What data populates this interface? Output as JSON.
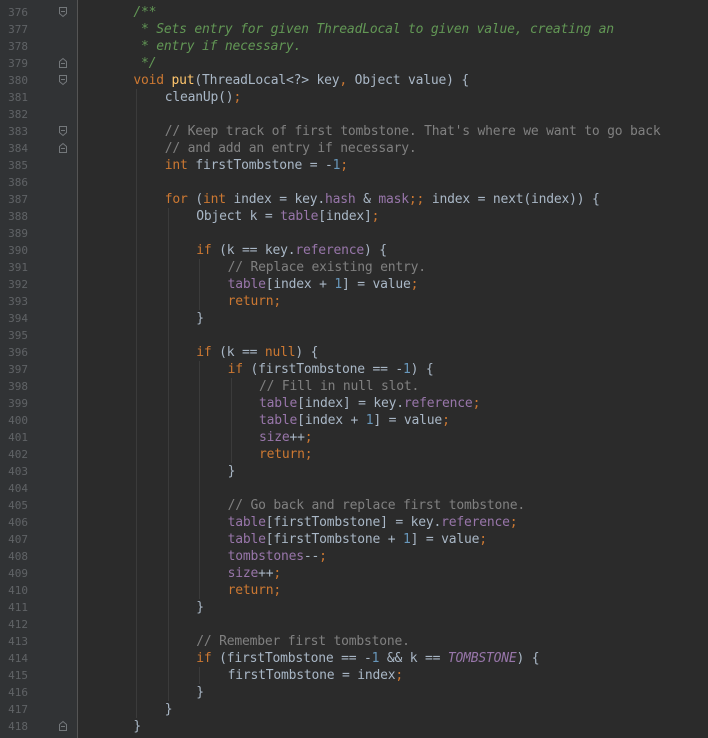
{
  "editor": {
    "colors": {
      "background": "#2b2b2b",
      "gutter": "#313335",
      "line_number": "#606366",
      "plain": "#a9b7c6",
      "keyword": "#cc7832",
      "method": "#ffc66d",
      "number": "#6897bb",
      "field": "#9876aa",
      "comment": "#808080",
      "doc_comment": "#629755"
    },
    "lines": [
      {
        "num": "376",
        "fold": "top",
        "indent": 1,
        "tokens": [
          {
            "t": "doc",
            "v": "/**"
          }
        ]
      },
      {
        "num": "377",
        "indent": 1,
        "tokens": [
          {
            "t": "doc",
            "v": " * Sets entry for given ThreadLocal to given value, creating an"
          }
        ]
      },
      {
        "num": "378",
        "indent": 1,
        "tokens": [
          {
            "t": "doc",
            "v": " * entry if necessary."
          }
        ]
      },
      {
        "num": "379",
        "fold": "bottom",
        "indent": 1,
        "tokens": [
          {
            "t": "doc",
            "v": " */"
          }
        ]
      },
      {
        "num": "380",
        "fold": "top",
        "indent": 1,
        "tokens": [
          {
            "t": "kw",
            "v": "void "
          },
          {
            "t": "fn",
            "v": "put"
          },
          {
            "t": "plain",
            "v": "(ThreadLocal<?> key"
          },
          {
            "t": "kw",
            "v": ", "
          },
          {
            "t": "plain",
            "v": "Object value) {"
          }
        ]
      },
      {
        "num": "381",
        "indent": 2,
        "tokens": [
          {
            "t": "plain",
            "v": "cleanUp()"
          },
          {
            "t": "kw",
            "v": ";"
          }
        ]
      },
      {
        "num": "382",
        "indent": 0,
        "tokens": []
      },
      {
        "num": "383",
        "fold": "top",
        "indent": 2,
        "tokens": [
          {
            "t": "com",
            "v": "// Keep track of first tombstone. That's where we want to go back"
          }
        ]
      },
      {
        "num": "384",
        "fold": "bottom",
        "indent": 2,
        "tokens": [
          {
            "t": "com",
            "v": "// and add an entry if necessary."
          }
        ]
      },
      {
        "num": "385",
        "indent": 2,
        "tokens": [
          {
            "t": "kw",
            "v": "int "
          },
          {
            "t": "plain",
            "v": "firstTombstone = -"
          },
          {
            "t": "num",
            "v": "1"
          },
          {
            "t": "kw",
            "v": ";"
          }
        ]
      },
      {
        "num": "386",
        "indent": 0,
        "tokens": []
      },
      {
        "num": "387",
        "indent": 2,
        "tokens": [
          {
            "t": "kw",
            "v": "for "
          },
          {
            "t": "plain",
            "v": "("
          },
          {
            "t": "kw",
            "v": "int "
          },
          {
            "t": "plain",
            "v": "index = key."
          },
          {
            "t": "field",
            "v": "hash "
          },
          {
            "t": "plain",
            "v": "& "
          },
          {
            "t": "field",
            "v": "mask"
          },
          {
            "t": "kw",
            "v": ";; "
          },
          {
            "t": "plain",
            "v": "index = next(index)) {"
          }
        ]
      },
      {
        "num": "388",
        "indent": 3,
        "tokens": [
          {
            "t": "plain",
            "v": "Object k = "
          },
          {
            "t": "field",
            "v": "table"
          },
          {
            "t": "plain",
            "v": "[index]"
          },
          {
            "t": "kw",
            "v": ";"
          }
        ]
      },
      {
        "num": "389",
        "indent": 0,
        "tokens": []
      },
      {
        "num": "390",
        "indent": 3,
        "tokens": [
          {
            "t": "kw",
            "v": "if "
          },
          {
            "t": "plain",
            "v": "(k == key."
          },
          {
            "t": "field",
            "v": "reference"
          },
          {
            "t": "plain",
            "v": ") {"
          }
        ]
      },
      {
        "num": "391",
        "indent": 4,
        "tokens": [
          {
            "t": "com",
            "v": "// Replace existing entry."
          }
        ]
      },
      {
        "num": "392",
        "indent": 4,
        "tokens": [
          {
            "t": "field",
            "v": "table"
          },
          {
            "t": "plain",
            "v": "[index + "
          },
          {
            "t": "num",
            "v": "1"
          },
          {
            "t": "plain",
            "v": "] = value"
          },
          {
            "t": "kw",
            "v": ";"
          }
        ]
      },
      {
        "num": "393",
        "indent": 4,
        "tokens": [
          {
            "t": "kw",
            "v": "return;"
          }
        ]
      },
      {
        "num": "394",
        "indent": 3,
        "tokens": [
          {
            "t": "plain",
            "v": "}"
          }
        ]
      },
      {
        "num": "395",
        "indent": 0,
        "tokens": []
      },
      {
        "num": "396",
        "indent": 3,
        "tokens": [
          {
            "t": "kw",
            "v": "if "
          },
          {
            "t": "plain",
            "v": "(k == "
          },
          {
            "t": "kw",
            "v": "null"
          },
          {
            "t": "plain",
            "v": ") {"
          }
        ]
      },
      {
        "num": "397",
        "indent": 4,
        "tokens": [
          {
            "t": "kw",
            "v": "if "
          },
          {
            "t": "plain",
            "v": "(firstTombstone == -"
          },
          {
            "t": "num",
            "v": "1"
          },
          {
            "t": "plain",
            "v": ") {"
          }
        ]
      },
      {
        "num": "398",
        "indent": 5,
        "tokens": [
          {
            "t": "com",
            "v": "// Fill in null slot."
          }
        ]
      },
      {
        "num": "399",
        "indent": 5,
        "tokens": [
          {
            "t": "field",
            "v": "table"
          },
          {
            "t": "plain",
            "v": "[index] = key."
          },
          {
            "t": "field",
            "v": "reference"
          },
          {
            "t": "kw",
            "v": ";"
          }
        ]
      },
      {
        "num": "400",
        "indent": 5,
        "tokens": [
          {
            "t": "field",
            "v": "table"
          },
          {
            "t": "plain",
            "v": "[index + "
          },
          {
            "t": "num",
            "v": "1"
          },
          {
            "t": "plain",
            "v": "] = value"
          },
          {
            "t": "kw",
            "v": ";"
          }
        ]
      },
      {
        "num": "401",
        "indent": 5,
        "tokens": [
          {
            "t": "field",
            "v": "size"
          },
          {
            "t": "plain",
            "v": "++"
          },
          {
            "t": "kw",
            "v": ";"
          }
        ]
      },
      {
        "num": "402",
        "indent": 5,
        "tokens": [
          {
            "t": "kw",
            "v": "return;"
          }
        ]
      },
      {
        "num": "403",
        "indent": 4,
        "tokens": [
          {
            "t": "plain",
            "v": "}"
          }
        ]
      },
      {
        "num": "404",
        "indent": 0,
        "tokens": []
      },
      {
        "num": "405",
        "indent": 4,
        "tokens": [
          {
            "t": "com",
            "v": "// Go back and replace first tombstone."
          }
        ]
      },
      {
        "num": "406",
        "indent": 4,
        "tokens": [
          {
            "t": "field",
            "v": "table"
          },
          {
            "t": "plain",
            "v": "[firstTombstone] = key."
          },
          {
            "t": "field",
            "v": "reference"
          },
          {
            "t": "kw",
            "v": ";"
          }
        ]
      },
      {
        "num": "407",
        "indent": 4,
        "tokens": [
          {
            "t": "field",
            "v": "table"
          },
          {
            "t": "plain",
            "v": "[firstTombstone + "
          },
          {
            "t": "num",
            "v": "1"
          },
          {
            "t": "plain",
            "v": "] = value"
          },
          {
            "t": "kw",
            "v": ";"
          }
        ]
      },
      {
        "num": "408",
        "indent": 4,
        "tokens": [
          {
            "t": "field",
            "v": "tombstones"
          },
          {
            "t": "plain",
            "v": "--"
          },
          {
            "t": "kw",
            "v": ";"
          }
        ]
      },
      {
        "num": "409",
        "indent": 4,
        "tokens": [
          {
            "t": "field",
            "v": "size"
          },
          {
            "t": "plain",
            "v": "++"
          },
          {
            "t": "kw",
            "v": ";"
          }
        ]
      },
      {
        "num": "410",
        "indent": 4,
        "tokens": [
          {
            "t": "kw",
            "v": "return;"
          }
        ]
      },
      {
        "num": "411",
        "indent": 3,
        "tokens": [
          {
            "t": "plain",
            "v": "}"
          }
        ]
      },
      {
        "num": "412",
        "indent": 0,
        "tokens": []
      },
      {
        "num": "413",
        "indent": 3,
        "tokens": [
          {
            "t": "com",
            "v": "// Remember first tombstone."
          }
        ]
      },
      {
        "num": "414",
        "indent": 3,
        "tokens": [
          {
            "t": "kw",
            "v": "if "
          },
          {
            "t": "plain",
            "v": "(firstTombstone == -"
          },
          {
            "t": "num",
            "v": "1 "
          },
          {
            "t": "plain",
            "v": "&& k == "
          },
          {
            "t": "static",
            "v": "TOMBSTONE"
          },
          {
            "t": "plain",
            "v": ") {"
          }
        ]
      },
      {
        "num": "415",
        "indent": 4,
        "tokens": [
          {
            "t": "plain",
            "v": "firstTombstone = index"
          },
          {
            "t": "kw",
            "v": ";"
          }
        ]
      },
      {
        "num": "416",
        "indent": 3,
        "tokens": [
          {
            "t": "plain",
            "v": "}"
          }
        ]
      },
      {
        "num": "417",
        "indent": 2,
        "tokens": [
          {
            "t": "plain",
            "v": "}"
          }
        ]
      },
      {
        "num": "418",
        "fold": "bottom",
        "indent": 1,
        "tokens": [
          {
            "t": "plain",
            "v": "}"
          }
        ]
      }
    ]
  }
}
